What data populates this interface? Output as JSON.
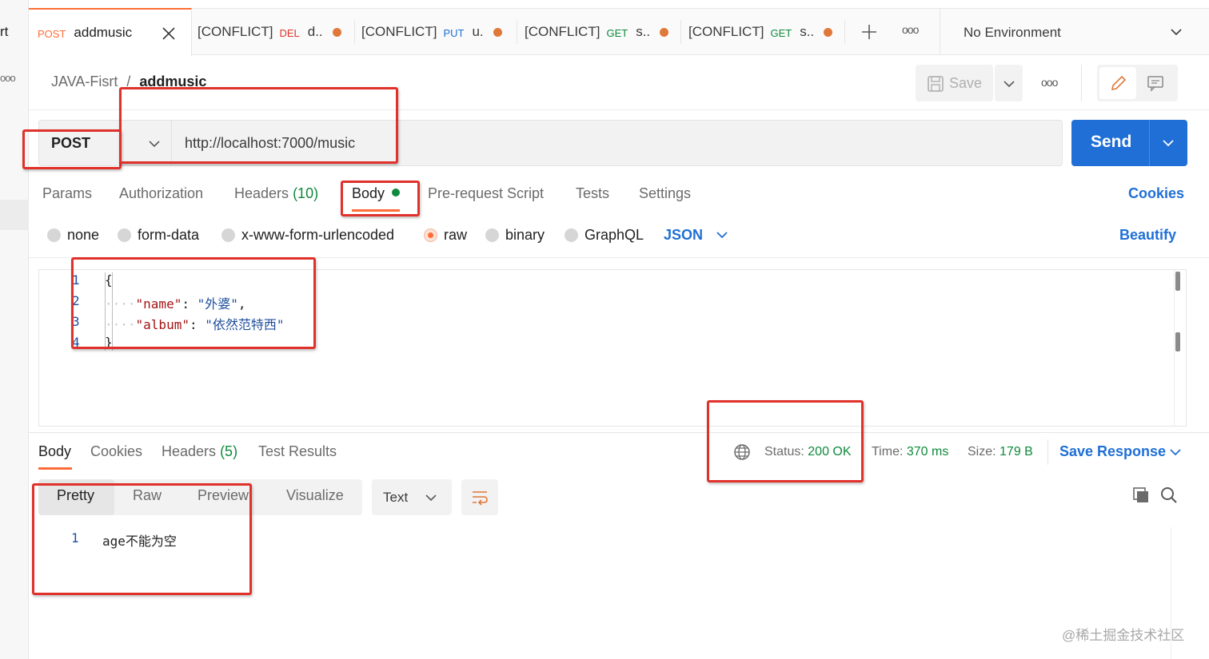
{
  "left_strip": {
    "label": "rt",
    "more": "ooo"
  },
  "tabs": [
    {
      "method": "POST",
      "method_color": "#ff6c37",
      "title": "addmusic",
      "active": true
    },
    {
      "prefix": "[CONFLICT]",
      "method": "DEL",
      "method_color": "#d9372b",
      "title": "d.."
    },
    {
      "prefix": "[CONFLICT]",
      "method": "PUT",
      "method_color": "#1f6fd6",
      "title": "u."
    },
    {
      "prefix": "[CONFLICT]",
      "method": "GET",
      "method_color": "#0f8a3c",
      "title": "s.."
    },
    {
      "prefix": "[CONFLICT]",
      "method": "GET",
      "method_color": "#0f8a3c",
      "title": "s.."
    }
  ],
  "tab_more": "ooo",
  "environment": "No Environment",
  "breadcrumb": {
    "collection": "JAVA-Fisrt",
    "separator": "/",
    "request": "addmusic"
  },
  "toolbar": {
    "save_label": "Save",
    "more": "ooo"
  },
  "request": {
    "method": "POST",
    "url": "http://localhost:7000/music",
    "send_label": "Send"
  },
  "request_tabs": {
    "params": "Params",
    "authorization": "Authorization",
    "headers": "Headers",
    "headers_count": "(10)",
    "body": "Body",
    "prerequest": "Pre-request Script",
    "tests": "Tests",
    "settings": "Settings",
    "cookies": "Cookies"
  },
  "body_types": {
    "none": "none",
    "form_data": "form-data",
    "urlencoded": "x-www-form-urlencoded",
    "raw": "raw",
    "binary": "binary",
    "graphql": "GraphQL",
    "format": "JSON",
    "beautify": "Beautify"
  },
  "editor": {
    "line_numbers": [
      "1",
      "2",
      "3",
      "4"
    ],
    "lines": {
      "open": "{",
      "key1": "\"name\"",
      "val1": "\"外婆\"",
      "key2": "\"album\"",
      "val2": "\"依然范特西\"",
      "close": "}"
    },
    "colon": ":",
    "comma": ",",
    "indent_dots": "····"
  },
  "response_tabs": {
    "body": "Body",
    "cookies": "Cookies",
    "headers": "Headers",
    "headers_count": "(5)",
    "test_results": "Test Results"
  },
  "response_meta": {
    "status_label": "Status:",
    "status_value": "200 OK",
    "time_label": "Time:",
    "time_value": "370 ms",
    "size_label": "Size:",
    "size_value": "179 B",
    "save_response": "Save Response"
  },
  "response_views": {
    "pretty": "Pretty",
    "raw": "Raw",
    "preview": "Preview",
    "visualize": "Visualize",
    "format": "Text"
  },
  "response_body": {
    "line_number": "1",
    "text": "age不能为空"
  },
  "watermark": "@稀土掘金技术社区",
  "colors": {
    "accent_orange": "#ff6c37",
    "send_blue": "#1f6fd6",
    "highlight_red": "#e0312b",
    "status_green": "#0f8a3c"
  }
}
